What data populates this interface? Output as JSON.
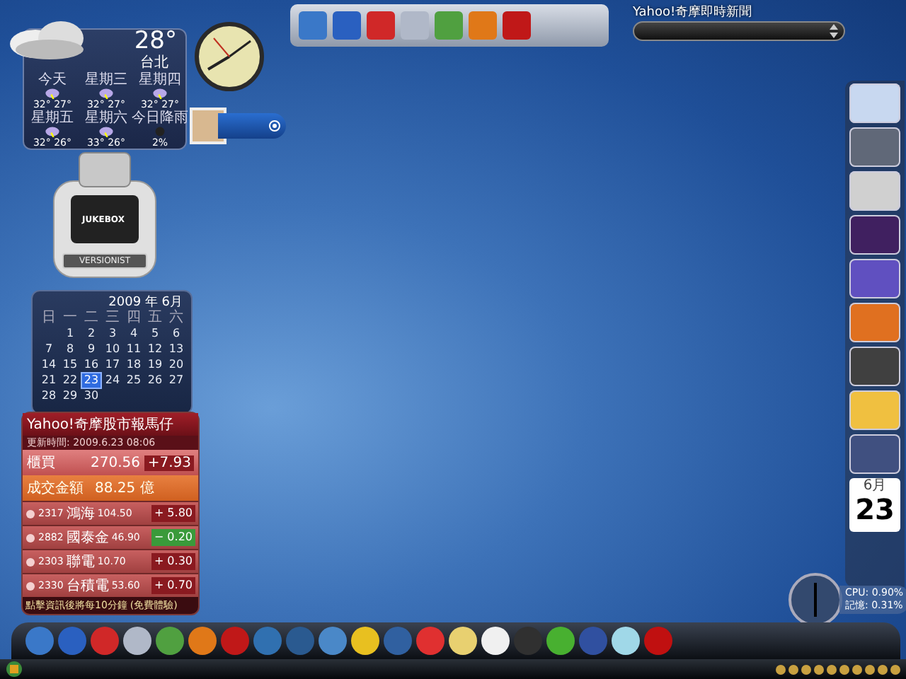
{
  "weather": {
    "temperature": "28°",
    "city": "台北",
    "forecast": [
      {
        "day": "今天",
        "high": "32°",
        "low": "27°"
      },
      {
        "day": "星期三",
        "high": "32°",
        "low": "27°"
      },
      {
        "day": "星期四",
        "high": "32°",
        "low": "27°"
      },
      {
        "day": "星期五",
        "high": "32°",
        "low": "26°"
      },
      {
        "day": "星期六",
        "high": "33°",
        "low": "26°"
      }
    ],
    "rain": {
      "label": "今日降雨",
      "value": "2%"
    }
  },
  "jukebox": {
    "logo": "JUKEBOX",
    "button": "VERSIONIST"
  },
  "news": {
    "title": "Yahoo!奇摩即時新聞"
  },
  "calendar": {
    "title": "2009 年 6月",
    "weekdays": [
      "日",
      "一",
      "二",
      "三",
      "四",
      "五",
      "六"
    ],
    "days": [
      {
        "label": "1",
        "selected": false
      },
      {
        "label": "2",
        "selected": false
      },
      {
        "label": "3",
        "selected": false
      },
      {
        "label": "4",
        "selected": false
      },
      {
        "label": "5",
        "selected": false
      },
      {
        "label": "6",
        "selected": false
      },
      {
        "label": "7",
        "selected": false
      },
      {
        "label": "8",
        "selected": false
      },
      {
        "label": "9",
        "selected": false
      },
      {
        "label": "10",
        "selected": false
      },
      {
        "label": "11",
        "selected": false
      },
      {
        "label": "12",
        "selected": false
      },
      {
        "label": "13",
        "selected": false
      },
      {
        "label": "14",
        "selected": false
      },
      {
        "label": "15",
        "selected": false
      },
      {
        "label": "16",
        "selected": false
      },
      {
        "label": "17",
        "selected": false
      },
      {
        "label": "18",
        "selected": false
      },
      {
        "label": "19",
        "selected": false
      },
      {
        "label": "20",
        "selected": false
      },
      {
        "label": "21",
        "selected": false
      },
      {
        "label": "22",
        "selected": false
      },
      {
        "label": "23",
        "selected": true
      },
      {
        "label": "24",
        "selected": false
      },
      {
        "label": "25",
        "selected": false
      },
      {
        "label": "26",
        "selected": false
      },
      {
        "label": "27",
        "selected": false
      },
      {
        "label": "28",
        "selected": false
      },
      {
        "label": "29",
        "selected": false
      },
      {
        "label": "30",
        "selected": false
      }
    ]
  },
  "stock": {
    "title": "Yahoo!奇摩股市報馬仔",
    "updated": "更新時間: 2009.6.23 08:06",
    "index": {
      "name": "櫃買",
      "value": "270.56",
      "change": "+7.93"
    },
    "volume": {
      "label": "成交金額",
      "value": "88.25 億"
    },
    "rows": [
      {
        "code": "2317",
        "name": "鴻海",
        "price": "104.50",
        "change": "+ 5.80",
        "kind": "up"
      },
      {
        "code": "2882",
        "name": "國泰金",
        "price": "46.90",
        "change": "− 0.20",
        "kind": "down"
      },
      {
        "code": "2303",
        "name": "聯電",
        "price": "10.70",
        "change": "+ 0.30",
        "kind": "up"
      },
      {
        "code": "2330",
        "name": "台積電",
        "price": "53.60",
        "change": "+ 0.70",
        "kind": "up"
      }
    ],
    "footer": "點擊資訊後將每10分鐘",
    "footer_link": "(免費體驗)"
  },
  "side_calendar": {
    "month": "6月",
    "day": "23"
  },
  "meter": {
    "cpu": "CPU: 0.90%",
    "memory": "記憶: 0.31%"
  }
}
